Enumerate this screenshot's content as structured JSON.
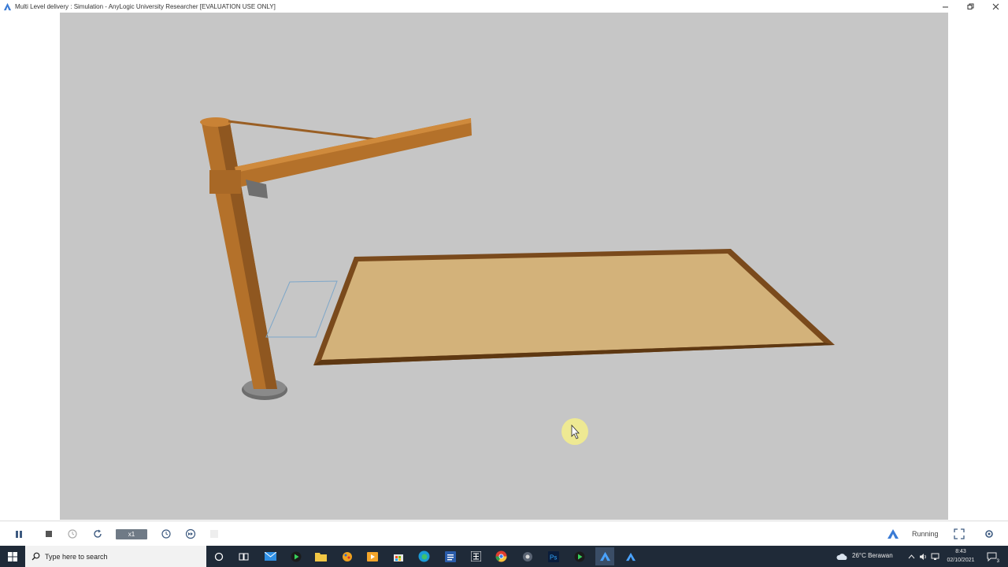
{
  "window": {
    "title": "Multi Level delivery : Simulation - AnyLogic University Researcher [EVALUATION USE ONLY]",
    "minimize_icon": "minimize-icon",
    "restore_icon": "restore-icon",
    "close_icon": "close-icon"
  },
  "simulation": {
    "speed_label": "x1",
    "status": "Running"
  },
  "taskbar": {
    "search_placeholder": "Type here to search",
    "weather": "26°C  Berawan",
    "time": "8:43",
    "date": "02/10/2021",
    "notification_count": "3"
  },
  "colors": {
    "viewport_bg": "#c6c6c6",
    "crane_wood": "#b4712a",
    "table_top": "#d3b27a",
    "table_rim": "#7a4a1c",
    "taskbar_bg": "#1f2a38",
    "speed_box": "#6f7a86"
  }
}
